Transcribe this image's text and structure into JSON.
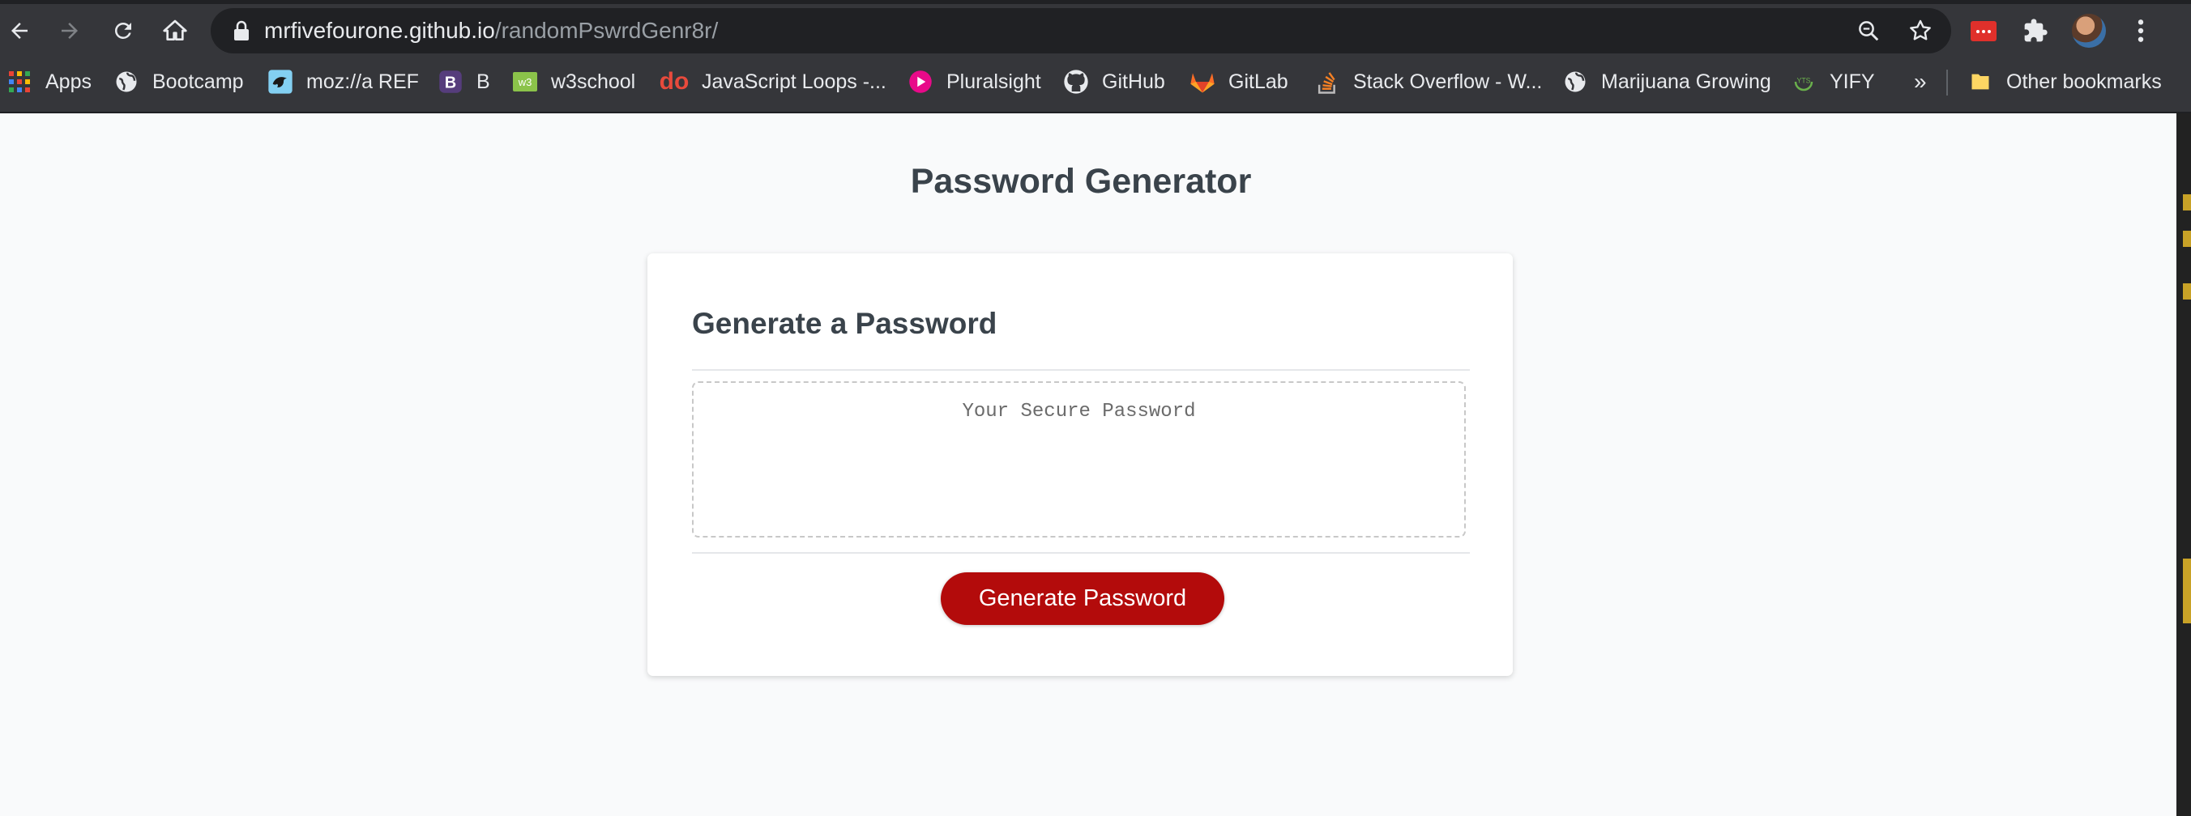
{
  "browser": {
    "url_host": "mrfivefourone.github.io",
    "url_path": "/randomPswrdGenr8r/",
    "icons": [
      "back-arrow-icon",
      "forward-arrow-icon",
      "reload-icon",
      "home-icon",
      "lock-icon",
      "zoom-icon",
      "star-icon",
      "extension-red-icon",
      "puzzle-icon",
      "avatar",
      "kebab-menu-icon"
    ]
  },
  "bookmarks": [
    {
      "label": "Apps",
      "icon": "apps-grid-icon"
    },
    {
      "label": "Bootcamp",
      "icon": "globe-icon"
    },
    {
      "label": "moz://a REF",
      "icon": "mozilla-icon"
    },
    {
      "label": "B",
      "icon": "bootstrap-icon"
    },
    {
      "label": "w3school",
      "icon": "w3schools-icon"
    },
    {
      "label": "JavaScript Loops -...",
      "icon": "do-icon"
    },
    {
      "label": "Pluralsight",
      "icon": "pluralsight-icon"
    },
    {
      "label": "GitHub",
      "icon": "github-icon"
    },
    {
      "label": "GitLab",
      "icon": "gitlab-icon"
    },
    {
      "label": "Stack Overflow - W...",
      "icon": "stackoverflow-icon"
    },
    {
      "label": "Marijuana Growing",
      "icon": "globe-icon"
    },
    {
      "label": "YIFY",
      "icon": "yify-icon"
    }
  ],
  "bookmarks_overflow": "»",
  "other_bookmarks": "Other bookmarks",
  "page": {
    "title": "Password Generator",
    "card_title": "Generate a Password",
    "password_placeholder": "Your Secure Password",
    "generate_button": "Generate Password"
  },
  "colors": {
    "button": "#b30b0b",
    "page_bg": "#f9fafb",
    "chrome_bg": "#35363a"
  }
}
